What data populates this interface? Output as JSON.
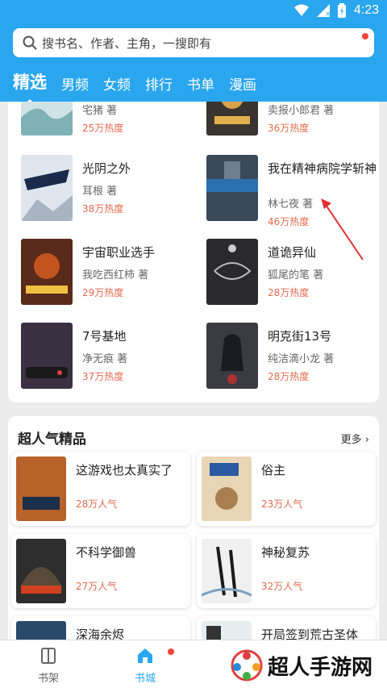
{
  "status": {
    "time": "4:23"
  },
  "search": {
    "placeholder": "搜书名、作者、主角，一搜即有"
  },
  "tabs": [
    "精选",
    "男频",
    "女频",
    "排行",
    "书单",
    "漫画"
  ],
  "books": [
    {
      "title": "",
      "author": "宅猪 著",
      "heat": "25万热度",
      "cover_color": "#cfe3e6"
    },
    {
      "title": "",
      "author": "卖报小郎君 著",
      "heat": "36万热度",
      "cover_color": "#3a3530"
    },
    {
      "title": "光阴之外",
      "author": "耳根 著",
      "heat": "38万热度",
      "cover_color": "#dfe5ec"
    },
    {
      "title": "我在精神病院学斩神",
      "author": "林七夜 著",
      "heat": "46万热度",
      "cover_color": "#3a4a5a"
    },
    {
      "title": "宇宙职业选手",
      "author": "我吃西红柿 著",
      "heat": "29万热度",
      "cover_color": "#5a2a1a"
    },
    {
      "title": "道诡异仙",
      "author": "狐尾的笔 著",
      "heat": "28万热度",
      "cover_color": "#2a2a2e"
    },
    {
      "title": "7号基地",
      "author": "净无痕 著",
      "heat": "37万热度",
      "cover_color": "#3a3042"
    },
    {
      "title": "明克街13号",
      "author": "纯洁滴小龙 著",
      "heat": "28万热度",
      "cover_color": "#3b3b44"
    }
  ],
  "popular": {
    "title": "超人气精品",
    "more": "更多",
    "items": [
      {
        "title": "这游戏也太真实了",
        "heat": "28万人气",
        "cover_color": "#b8622a"
      },
      {
        "title": "俗主",
        "heat": "23万人气",
        "cover_color": "#e8d5b5"
      },
      {
        "title": "不科学御兽",
        "heat": "27万人气",
        "cover_color": "#2e2e2e"
      },
      {
        "title": "神秘复苏",
        "heat": "32万人气",
        "cover_color": "#f0f0f0"
      },
      {
        "title": "深海余烬",
        "heat": "",
        "cover_color": "#2a4a6a"
      },
      {
        "title": "开局签到荒古圣体",
        "heat": "",
        "cover_color": "#e8eef0"
      }
    ]
  },
  "bottom_nav": [
    {
      "label": "书架",
      "color": "#666666"
    },
    {
      "label": "书城",
      "color": "#2aa6ee"
    }
  ],
  "watermark": {
    "text": "超人手游网"
  },
  "colors": {
    "header": "#2aa6ee",
    "heat": "#e26a4f",
    "badge": "#f0463c"
  }
}
